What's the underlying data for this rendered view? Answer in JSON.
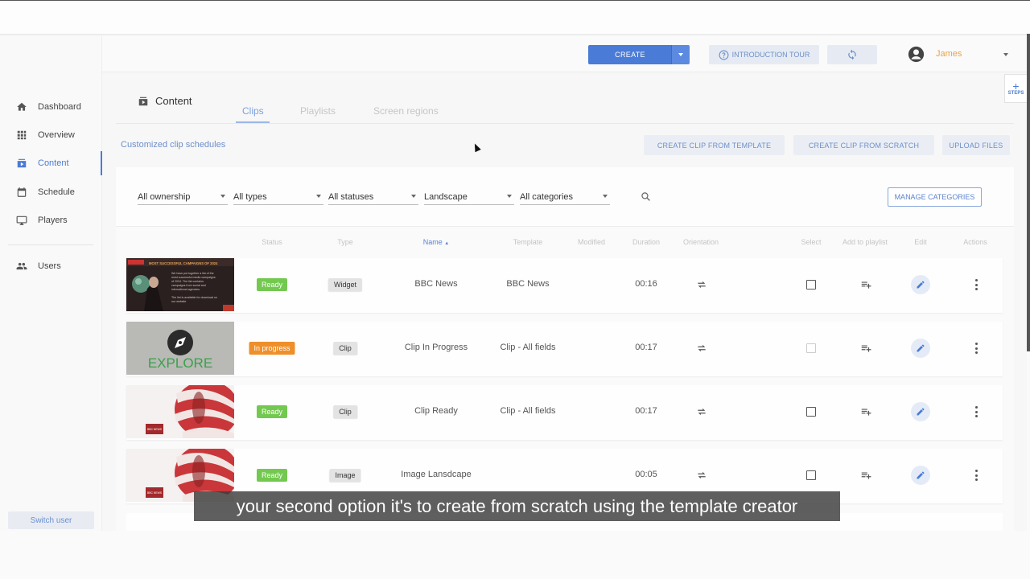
{
  "sidebar": {
    "items": [
      {
        "label": "Dashboard",
        "icon": "home-icon"
      },
      {
        "label": "Overview",
        "icon": "grid-icon"
      },
      {
        "label": "Content",
        "icon": "content-icon"
      },
      {
        "label": "Schedule",
        "icon": "calendar-icon"
      },
      {
        "label": "Players",
        "icon": "monitor-icon"
      },
      {
        "label": "Users",
        "icon": "users-icon"
      }
    ],
    "active": "Content",
    "switch_user_label": "Switch user"
  },
  "topbar": {
    "create_label": "CREATE",
    "tour_label": "INTRODUCTION TOUR",
    "user_name": "James"
  },
  "steps_tab": {
    "plus": "+",
    "label": "STEPS"
  },
  "page": {
    "title": "Content",
    "tabs": [
      "Clips",
      "Playlists",
      "Screen regions"
    ],
    "active_tab": "Clips",
    "schedules_link": "Customized clip schedules",
    "actions": [
      "CREATE CLIP FROM TEMPLATE",
      "CREATE CLIP FROM SCRATCH",
      "UPLOAD FILES"
    ]
  },
  "filters": {
    "ownership": "All ownership",
    "types": "All types",
    "statuses": "All statuses",
    "orientation": "Landscape",
    "categories": "All categories",
    "manage_label": "MANAGE CATEGORIES"
  },
  "table": {
    "columns": [
      "Status",
      "Type",
      "Name",
      "Template",
      "Modified",
      "Duration",
      "Orientation",
      "Select",
      "Add to playlist",
      "Edit",
      "Actions"
    ],
    "sorted_column": "Name",
    "sort_indicator": "▲",
    "rows": [
      {
        "status": "Ready",
        "status_kind": "ready",
        "type": "Widget",
        "name": "BBC News",
        "template": "BBC News",
        "modified": "",
        "duration": "00:16",
        "select_enabled": true,
        "thumb": {
          "headline": "MOST SUCCESSFUL CAMPAIGNS OF 2024",
          "lines": [
            "We have put together a list of the",
            "most successful media campaigns",
            "of 2024. The list contains",
            "campaigns from social and",
            "international agencies.",
            "",
            "The list is available for download on",
            "our website"
          ]
        }
      },
      {
        "status": "In progress",
        "status_kind": "progress",
        "type": "Clip",
        "name": "Clip In Progress",
        "template": "Clip - All fields",
        "modified": "",
        "duration": "00:17",
        "select_enabled": false,
        "thumb": {
          "headline": "EXPLORE"
        }
      },
      {
        "status": "Ready",
        "status_kind": "ready",
        "type": "Clip",
        "name": "Clip Ready",
        "template": "Clip - All fields",
        "modified": "",
        "duration": "00:17",
        "select_enabled": true,
        "thumb": {
          "headline": "BBC NEWS"
        }
      },
      {
        "status": "Ready",
        "status_kind": "ready",
        "type": "Image",
        "name": "Image Lansdcape",
        "template": "",
        "modified": "",
        "duration": "00:05",
        "select_enabled": true,
        "thumb": {
          "headline": "BBC NEWS"
        }
      }
    ]
  },
  "caption": "your second option it's to create from scratch using the template creator",
  "colors": {
    "accent": "#4a7bd6",
    "ready": "#73c94f",
    "in_progress": "#ef8f2a",
    "user_name": "#e8a34a"
  }
}
